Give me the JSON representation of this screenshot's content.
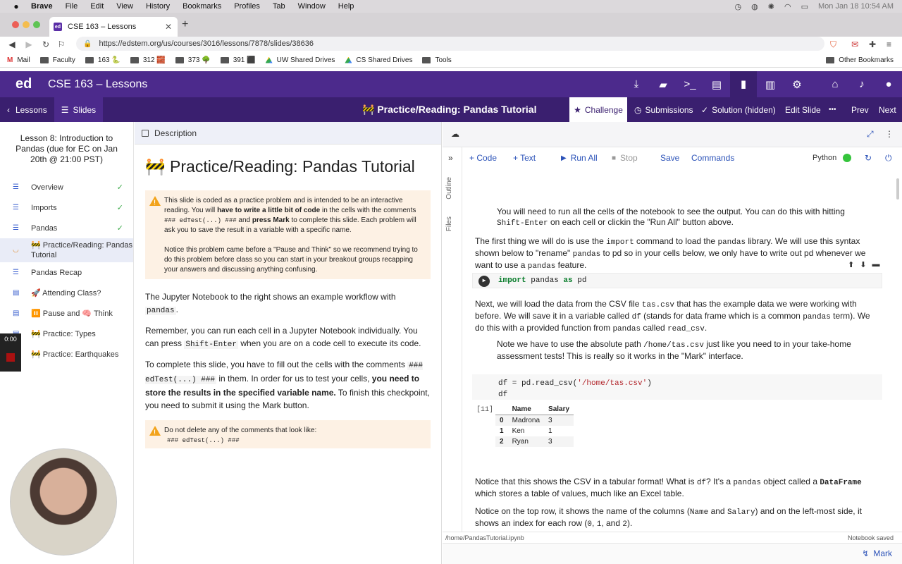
{
  "menubar": {
    "app": "Brave",
    "items": [
      "File",
      "Edit",
      "View",
      "History",
      "Bookmarks",
      "Profiles",
      "Tab",
      "Window",
      "Help"
    ],
    "clock": "Mon Jan 18  10:54 AM"
  },
  "browser": {
    "tab_title": "CSE 163 – Lessons",
    "url": "https://edstem.org/us/courses/3016/lessons/7878/slides/38636",
    "bookmarks": [
      "Mail",
      "Faculty",
      "163 🐍",
      "312 🧱",
      "373 🌳",
      "391 ⬛",
      "UW Shared Drives",
      "CS Shared Drives",
      "Tools"
    ],
    "other_bookmarks": "Other Bookmarks"
  },
  "ed": {
    "logo": "ed",
    "course": "CSE 163 – Lessons"
  },
  "subbar": {
    "lessons": "Lessons",
    "slides": "Slides",
    "slide_title": "🚧 Practice/Reading: Pandas Tutorial",
    "challenge": "Challenge",
    "submissions": "Submissions",
    "solution": "Solution (hidden)",
    "edit_slide": "Edit Slide",
    "more": "•••",
    "prev": "Prev",
    "next": "Next"
  },
  "sidebar": {
    "lesson_title": "Lesson 8: Introduction to Pandas (due for EC on Jan 20th @ 21:00 PST)",
    "items": [
      {
        "label": "Overview",
        "icon": "☰",
        "done": "✓"
      },
      {
        "label": "Imports",
        "icon": "☰",
        "done": "✓"
      },
      {
        "label": "Pandas",
        "icon": "☰",
        "done": "✓"
      },
      {
        "label": "🚧 Practice/Reading: Pandas Tutorial",
        "icon": "◡",
        "done": ""
      },
      {
        "label": "Pandas Recap",
        "icon": "☰",
        "done": ""
      },
      {
        "label": "🚀 Attending Class?",
        "icon": "▤",
        "done": ""
      },
      {
        "label": "⏸️ Pause and 🧠 Think",
        "icon": "▤",
        "done": ""
      },
      {
        "label": "🚧 Practice: Types",
        "icon": "▤",
        "done": ""
      },
      {
        "label": "🚧 Practice: Earthquakes",
        "icon": "◡",
        "done": ""
      }
    ],
    "timer": "0:00"
  },
  "description": {
    "header": "Description",
    "title": "🚧 Practice/Reading: Pandas Tutorial",
    "warn1_a": "This slide is coded as a practice problem and is intended to be an interactive reading. You will ",
    "warn1_b": "have to write a little bit of code",
    "warn1_c": " in the cells with the comments ",
    "warn1_code": "### edTest(...) ###",
    "warn1_d": " and ",
    "warn1_e": "press Mark",
    "warn1_f": " to complete this slide. Each problem will ask you to save the result in a variable with a specific name.",
    "warn1_p2": "Notice this problem came before a \"Pause and Think\" so we recommend trying to do this problem before class so you can start in your breakout groups recapping your answers and discussing anything confusing.",
    "p1_a": "The Jupyter Notebook to the right shows an example workflow with ",
    "p1_code": "pandas",
    "p1_b": ".",
    "p2_a": "Remember, you can run each cell in a Jupyter Notebook individually. You can press ",
    "p2_code": "Shift-Enter",
    "p2_b": " when you are on a code cell to execute its code.",
    "p3_a": "To complete this slide, you have to fill out the cells with the comments ",
    "p3_code": "### edTest(...) ###",
    "p3_b": " in them. In order for us to test your cells, ",
    "p3_bold": "you need to store the results in the specified variable name.",
    "p3_c": " To finish this checkpoint, you need to submit it using the Mark button.",
    "warn2": "Do not delete any of the comments that look like:",
    "warn2_code": "### edTest(...) ###"
  },
  "notebook": {
    "toolbar": {
      "code": "+ Code",
      "text": "+ Text",
      "run_all": "Run All",
      "stop": "Stop",
      "save": "Save",
      "commands": "Commands",
      "kernel": "Python"
    },
    "rail": {
      "outline": "Outline",
      "files": "Files"
    },
    "md1_a": "You will need to run all the cells of the notebook to see the output. You can do this with hitting ",
    "md1_code": "Shift-Enter",
    "md1_b": " on each cell or clickin the \"Run All\" button above.",
    "md2_a": "The first thing we will do is use the ",
    "md2_code1": "import",
    "md2_b": " command to load the ",
    "md2_code2": "pandas",
    "md2_c": " library. We will use this syntax shown below to \"rename\" ",
    "md2_code3": "pandas",
    "md2_d": " to pd so in your cells below, we only have to write out pd whenever we want to use a ",
    "md2_code4": "pandas",
    "md2_e": " feature.",
    "cell1": {
      "kw1": "import",
      "name": " pandas ",
      "kw2": "as",
      "alias": " pd"
    },
    "md3_a": "Next, we will load the data from the CSV file ",
    "md3_code1": "tas.csv",
    "md3_b": " that has the example data we were working with before. We will save it in a variable called ",
    "md3_code2": "df",
    "md3_c": " (stands for data frame which is a common ",
    "md3_code3": "pandas",
    "md3_d": " term). We do this with a provided function from ",
    "md3_code4": "pandas",
    "md3_e": " called ",
    "md3_code5": "read_csv",
    "md3_f": ".",
    "md4_a": "Note we have to use the absolute path ",
    "md4_code": "/home/tas.csv",
    "md4_b": " just like you need to in your take-home assessment tests! This is really so it works in the \"Mark\" interface.",
    "cell2": {
      "prompt": "[ ]",
      "pre": "df = pd.read_csv(",
      "str": "'/home/tas.csv'",
      "post": ")",
      "line2": "df"
    },
    "out_prompt": "[11]",
    "df_table": {
      "columns": [
        "",
        "Name",
        "Salary"
      ],
      "rows": [
        [
          "0",
          "Madrona",
          "3"
        ],
        [
          "1",
          "Ken",
          "1"
        ],
        [
          "2",
          "Ryan",
          "3"
        ]
      ]
    },
    "md5_a": "Notice that this shows the CSV in a tabular format! What is ",
    "md5_code1": "df",
    "md5_b": "? It's a ",
    "md5_code2": "pandas",
    "md5_c": " object called a ",
    "md5_code3": "DataFrame",
    "md5_d": " which stores a table of values, much like an Excel table.",
    "md6_a": "Notice on the top row, it shows the name of the columns (",
    "md6_code1": "Name",
    "md6_b": " and ",
    "md6_code2": "Salary",
    "md6_c": ") and on the left-most side, it shows an index for each row (",
    "md6_code3": "0",
    "md6_d": ", ",
    "md6_code4": "1",
    "md6_e": ", and ",
    "md6_code5": "2",
    "md6_f": ").",
    "path": "/home/PandasTutorial.ipynb",
    "saved": "Notebook saved",
    "mark": "Mark"
  }
}
